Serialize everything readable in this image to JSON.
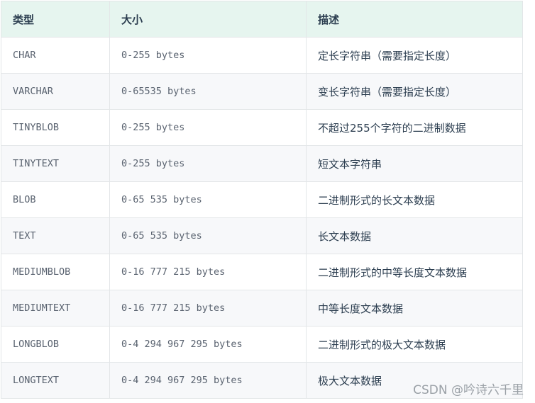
{
  "table": {
    "headers": [
      "类型",
      "大小",
      "描述"
    ],
    "rows": [
      {
        "type": "CHAR",
        "size": "0-255 bytes",
        "desc": "定长字符串（需要指定长度）"
      },
      {
        "type": "VARCHAR",
        "size": "0-65535 bytes",
        "desc": "变长字符串（需要指定长度）"
      },
      {
        "type": "TINYBLOB",
        "size": "0-255 bytes",
        "desc": "不超过255个字符的二进制数据"
      },
      {
        "type": "TINYTEXT",
        "size": "0-255 bytes",
        "desc": "短文本字符串"
      },
      {
        "type": "BLOB",
        "size": "0-65 535 bytes",
        "desc": "二进制形式的长文本数据"
      },
      {
        "type": "TEXT",
        "size": "0-65 535 bytes",
        "desc": "长文本数据"
      },
      {
        "type": "MEDIUMBLOB",
        "size": "0-16 777 215 bytes",
        "desc": "二进制形式的中等长度文本数据"
      },
      {
        "type": "MEDIUMTEXT",
        "size": "0-16 777 215 bytes",
        "desc": "中等长度文本数据"
      },
      {
        "type": "LONGBLOB",
        "size": "0-4 294 967 295 bytes",
        "desc": "二进制形式的极大文本数据"
      },
      {
        "type": "LONGTEXT",
        "size": "0-4 294 967 295 bytes",
        "desc": "极大文本数据"
      }
    ]
  },
  "watermark": "CSDN @吟诗六千里"
}
